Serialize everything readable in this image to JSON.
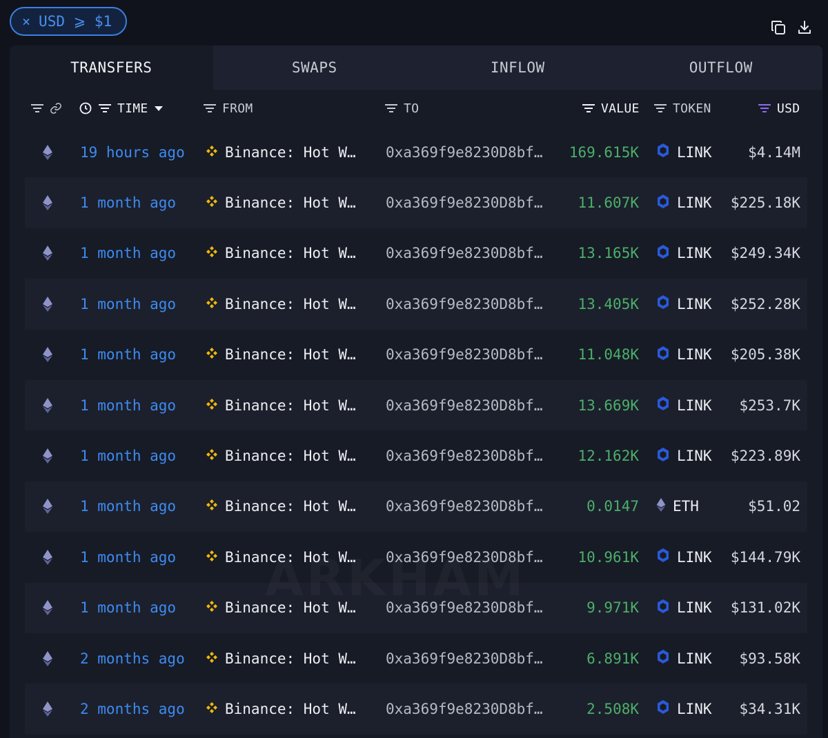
{
  "filter": {
    "close_glyph": "×",
    "label": "USD ⩾ $1"
  },
  "toolbar": {
    "icons": [
      "copy-icon",
      "download-icon"
    ]
  },
  "tabs": [
    {
      "label": "TRANSFERS",
      "active": true
    },
    {
      "label": "SWAPS",
      "active": false
    },
    {
      "label": "INFLOW",
      "active": false
    },
    {
      "label": "OUTFLOW",
      "active": false
    }
  ],
  "columns": {
    "time": "TIME",
    "from": "FROM",
    "to": "TO",
    "value": "VALUE",
    "token": "TOKEN",
    "usd": "USD"
  },
  "colors": {
    "accent_blue": "#3d8bf2",
    "value_green": "#4caf6a",
    "link_blue": "#2a5ada",
    "binance_yellow": "#f0b90b",
    "usd_filter_purple": "#8b6cf0"
  },
  "watermark": "ARKHAM",
  "rows": [
    {
      "time": "19 hours ago",
      "from": "Binance: Hot W…",
      "to": "0xa369f9e8230D8bf…",
      "value": "169.615K",
      "token": "LINK",
      "token_icon": "link-icon",
      "usd": "$4.14M"
    },
    {
      "time": "1 month ago",
      "from": "Binance: Hot W…",
      "to": "0xa369f9e8230D8bf…",
      "value": "11.607K",
      "token": "LINK",
      "token_icon": "link-icon",
      "usd": "$225.18K"
    },
    {
      "time": "1 month ago",
      "from": "Binance: Hot W…",
      "to": "0xa369f9e8230D8bf…",
      "value": "13.165K",
      "token": "LINK",
      "token_icon": "link-icon",
      "usd": "$249.34K"
    },
    {
      "time": "1 month ago",
      "from": "Binance: Hot W…",
      "to": "0xa369f9e8230D8bf…",
      "value": "13.405K",
      "token": "LINK",
      "token_icon": "link-icon",
      "usd": "$252.28K"
    },
    {
      "time": "1 month ago",
      "from": "Binance: Hot W…",
      "to": "0xa369f9e8230D8bf…",
      "value": "11.048K",
      "token": "LINK",
      "token_icon": "link-icon",
      "usd": "$205.38K"
    },
    {
      "time": "1 month ago",
      "from": "Binance: Hot W…",
      "to": "0xa369f9e8230D8bf…",
      "value": "13.669K",
      "token": "LINK",
      "token_icon": "link-icon",
      "usd": "$253.7K"
    },
    {
      "time": "1 month ago",
      "from": "Binance: Hot W…",
      "to": "0xa369f9e8230D8bf…",
      "value": "12.162K",
      "token": "LINK",
      "token_icon": "link-icon",
      "usd": "$223.89K"
    },
    {
      "time": "1 month ago",
      "from": "Binance: Hot W…",
      "to": "0xa369f9e8230D8bf…",
      "value": "0.0147",
      "token": "ETH",
      "token_icon": "eth-icon",
      "usd": "$51.02"
    },
    {
      "time": "1 month ago",
      "from": "Binance: Hot W…",
      "to": "0xa369f9e8230D8bf…",
      "value": "10.961K",
      "token": "LINK",
      "token_icon": "link-icon",
      "usd": "$144.79K"
    },
    {
      "time": "1 month ago",
      "from": "Binance: Hot W…",
      "to": "0xa369f9e8230D8bf…",
      "value": "9.971K",
      "token": "LINK",
      "token_icon": "link-icon",
      "usd": "$131.02K"
    },
    {
      "time": "2 months ago",
      "from": "Binance: Hot W…",
      "to": "0xa369f9e8230D8bf…",
      "value": "6.891K",
      "token": "LINK",
      "token_icon": "link-icon",
      "usd": "$93.58K"
    },
    {
      "time": "2 months ago",
      "from": "Binance: Hot W…",
      "to": "0xa369f9e8230D8bf…",
      "value": "2.508K",
      "token": "LINK",
      "token_icon": "link-icon",
      "usd": "$34.31K"
    }
  ]
}
